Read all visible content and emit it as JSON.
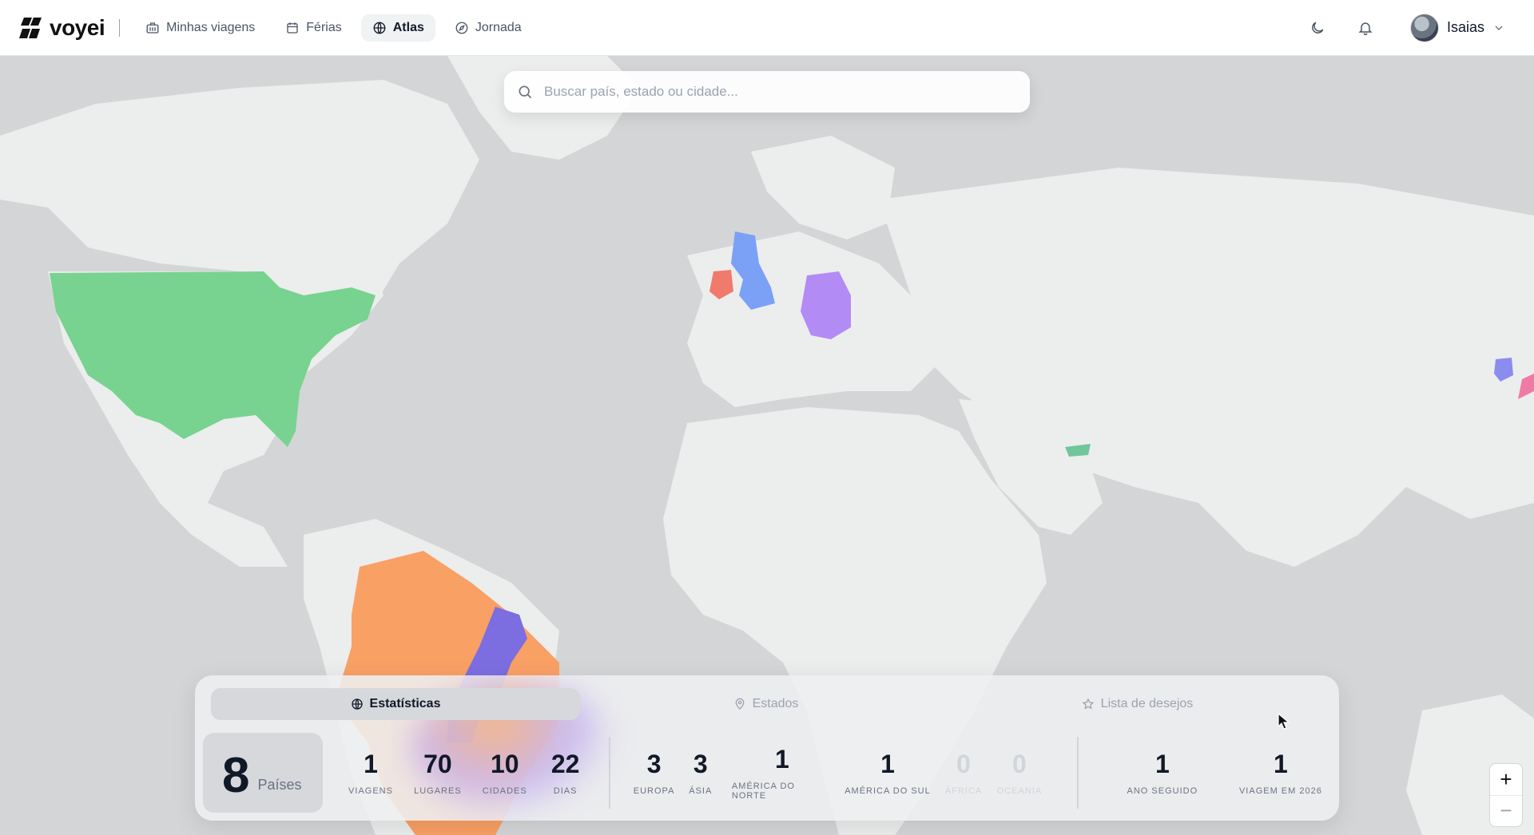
{
  "header": {
    "brand": "voyei",
    "nav": [
      {
        "label": "Minhas viagens",
        "icon": "building-icon"
      },
      {
        "label": "Férias",
        "icon": "calendar-icon"
      },
      {
        "label": "Atlas",
        "icon": "globe-icon",
        "active": true
      },
      {
        "label": "Jornada",
        "icon": "compass-icon"
      }
    ],
    "user_name": "Isaias"
  },
  "search": {
    "placeholder": "Buscar país, estado ou cidade..."
  },
  "map": {
    "visited_colors": {
      "united_states": "#77d38f",
      "brazil": "#f9a065",
      "brazil_states": "#7c6ee0",
      "united_kingdom": "#7aa1f6",
      "ireland": "#f07a6c",
      "germany": "#b38bf5",
      "uae": "#6fc69a"
    }
  },
  "panel": {
    "tabs": [
      {
        "label": "Estatísticas",
        "active": true
      },
      {
        "label": "Estados"
      },
      {
        "label": "Lista de desejos"
      }
    ],
    "countries": {
      "value": "8",
      "label": "Países"
    },
    "summary": [
      {
        "value": "1",
        "label": "Viagens"
      },
      {
        "value": "70",
        "label": "Lugares"
      },
      {
        "value": "10",
        "label": "Cidades"
      },
      {
        "value": "22",
        "label": "Dias"
      }
    ],
    "continents": [
      {
        "value": "3",
        "label": "Europa"
      },
      {
        "value": "3",
        "label": "Ásia"
      },
      {
        "value": "1",
        "label": "América do Norte"
      },
      {
        "value": "1",
        "label": "América do Sul"
      },
      {
        "value": "0",
        "label": "África"
      },
      {
        "value": "0",
        "label": "Oceania"
      }
    ],
    "streaks": [
      {
        "value": "1",
        "label": "Ano seguido"
      },
      {
        "value": "1",
        "label": "Viagem em 2026"
      }
    ]
  },
  "zoom": {
    "in": "+",
    "out": "−"
  }
}
